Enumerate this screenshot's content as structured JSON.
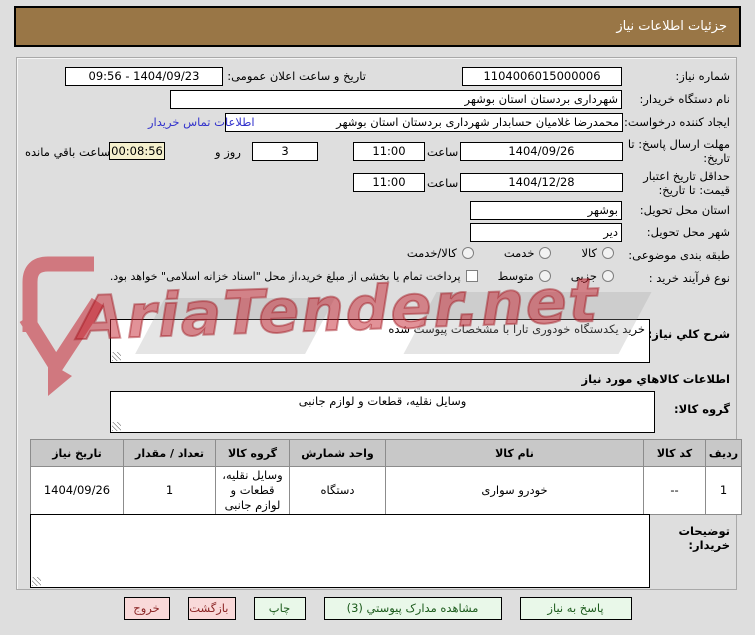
{
  "page": {
    "title": "جزئیات اطلاعات نیاز"
  },
  "watermark": {
    "text": "AriaTender.net"
  },
  "fields": {
    "need_number": {
      "label": "شماره نیاز:",
      "value": "1104006015000006"
    },
    "announce_datetime": {
      "label": "تاریخ و ساعت اعلان عمومی:",
      "value": "1404/09/23 - 09:56"
    },
    "buyer_org": {
      "label": "نام دستگاه خریدار:",
      "value": "شهرداری بردستان استان بوشهر"
    },
    "request_creator": {
      "label": "ایجاد کننده درخواست:",
      "value": "محمدرضا غلامیان حسابدار شهرداری بردستان استان بوشهر",
      "contact_link": "اطلاعات تماس خریدار"
    },
    "response_deadline": {
      "label": "مهلت ارسال پاسخ: تا تاریخ:",
      "date": "1404/09/26",
      "hour_label": "ساعت",
      "time": "11:00",
      "days_value": "3",
      "days_label": "روز و",
      "countdown": "00:08:56",
      "remaining_label": "ساعت باقي مانده"
    },
    "price_validity": {
      "label": "حداقل تاریخ اعتبار قیمت: تا تاریخ:",
      "date": "1404/12/28",
      "hour_label": "ساعت",
      "time": "11:00"
    },
    "delivery_province": {
      "label": "استان محل تحویل:",
      "value": "بوشهر"
    },
    "delivery_city": {
      "label": "شهر محل تحویل:",
      "value": "دیر"
    },
    "subject_class": {
      "label": "طبقه بندی موضوعی:",
      "options": [
        "کالا",
        "خدمت",
        "کالا/خدمت"
      ]
    },
    "purchase_process": {
      "label": "نوع فرآیند خرید :",
      "options": [
        "جزیی",
        "متوسط"
      ],
      "checkbox_label": "پرداخت تمام یا بخشی از مبلغ خرید،از محل \"اسناد خزانه اسلامی\" خواهد بود."
    },
    "need_description": {
      "label": "شرح کلي نیاز:",
      "value": "خرید یکدستگاه خودوری تارا با مشخصات پیوست شده"
    },
    "goods_section_title": "اطلاعات کالاهاي مورد نیاز",
    "goods_group": {
      "label": "گروه کالا:",
      "value": "وسایل نقلیه، قطعات و لوازم جانبی"
    },
    "buyer_notes": {
      "label": "توضیحات خریدار:",
      "value": ""
    }
  },
  "table": {
    "headers": [
      "ردیف",
      "کد کالا",
      "نام کالا",
      "واحد شمارش",
      "گروه کالا",
      "تعداد / مقدار",
      "تاریخ نیاز"
    ],
    "rows": [
      [
        "1",
        "--",
        "خودرو سواری",
        "دستگاه",
        "وسایل نقلیه، قطعات و لوازم جانبی",
        "1",
        "1404/09/26"
      ]
    ]
  },
  "buttons": {
    "respond": "پاسخ به نیاز",
    "view_docs": "مشاهده مدارک پیوستي (3)",
    "print": "چاپ",
    "back": "بازگشت",
    "exit": "خروج"
  },
  "colors": {
    "header_bg": "#997646",
    "countdown_bg": "#f5f0cd",
    "link_blue": "#3333cc",
    "button_green_bg": "#e9f8e9",
    "button_pink_bg": "#f9d9d9",
    "watermark_red": "#c62632",
    "table_header_bg": "#c8c8c8"
  }
}
